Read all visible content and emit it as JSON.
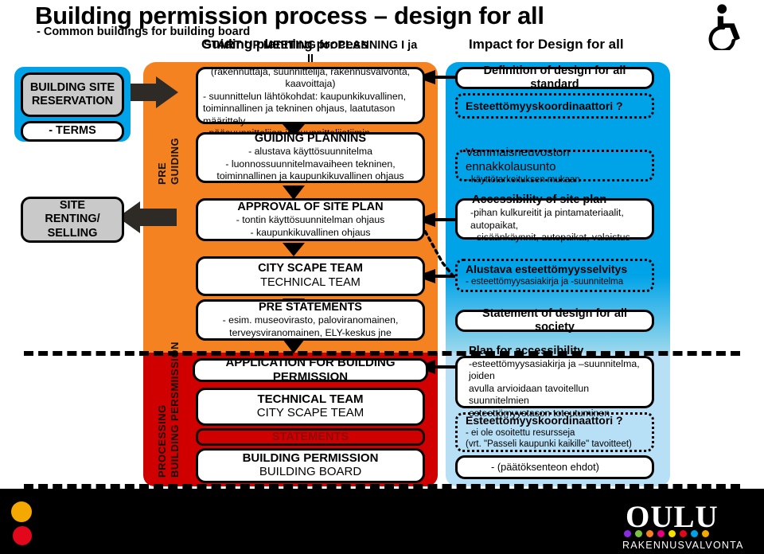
{
  "header": {
    "title": "Building permission process – design for all",
    "subtitle": "- Common buildings for building board",
    "column_middle": "Guiding planning process",
    "column_right": "Impact for Design for all",
    "icon": "wheelchair-accessibility-icon"
  },
  "bands": {
    "pre_guiding_label_line1": "PRE",
    "pre_guiding_label_line2": "GUIDING",
    "processing_label_line1": "PROCESSING",
    "processing_label_line2": "BUILDING PERSMIISSION",
    "orange_color": "#F58220",
    "red_color": "#D00000",
    "blue_color": "#00A3E8",
    "blue_light_color": "#B7E0F7"
  },
  "left_column": [
    {
      "id": "building-site-reservation",
      "title": "BUILDING SITE",
      "title2": "RESERVATION"
    },
    {
      "id": "terms",
      "title": "- TERMS"
    },
    {
      "id": "site-renting-selling",
      "title": "SITE",
      "title2": "RENTING/",
      "title3": "SELLING"
    }
  ],
  "middle_column": [
    {
      "id": "start-up-meeting",
      "heading": "START UP MEETING for PLANNING  I ja II",
      "lines": [
        "(rakennuttaja, suunnittelija, rakennusvalvonta, kaavoittaja)",
        "- suunnittelun lähtökohdat: kaupunkikuvallinen,",
        "  toiminnallinen ja tekninen ohjaus,  laatutason määrittely",
        "- pääsuunnittelijan ja suunnittelijatiimin kelpoisuus"
      ]
    },
    {
      "id": "guiding-plannins",
      "heading": "GUIDING PLANNINS",
      "lines": [
        "- alustava käyttösuunnitelma",
        "- luonnossuunnitelmavaiheen tekninen,",
        "toiminnallinen ja kaupunkikuvallinen ohjaus"
      ]
    },
    {
      "id": "approval-of-site-plan",
      "heading": "APPROVAL OF SITE PLAN",
      "lines": [
        "- tontin käyttösuunnitelman ohjaus",
        "- kaupunkikuvallinen ohjaus"
      ]
    },
    {
      "id": "city-scape-team",
      "heading": "CITY SCAPE TEAM",
      "lines": [
        "TECHNICAL TEAM"
      ]
    },
    {
      "id": "pre-statements",
      "heading": "PRE STATEMENTS",
      "lines": [
        "- esim. museovirasto, paloviranomainen,",
        "terveysviranomainen, ELY-keskus jne"
      ]
    },
    {
      "id": "application-for-building-permission",
      "heading": "APPLICATION FOR BUILDING PERMISSION",
      "lines": []
    },
    {
      "id": "technical-team",
      "heading": "TECHNICAL TEAM",
      "lines": [
        "CITY SCAPE TEAM"
      ]
    },
    {
      "id": "statements",
      "heading": "STATEMENTS",
      "lines": []
    },
    {
      "id": "building-permission",
      "heading": "BUILDING PERMISSION",
      "lines": [
        "BUILDING BOARD"
      ]
    }
  ],
  "right_column": [
    {
      "id": "definition-of-design-for-all-standard",
      "style": "solid",
      "heading": "Definition of design for all standard",
      "lines": []
    },
    {
      "id": "esteettomyyskoordinaattori-1",
      "style": "dotted",
      "heading": "Esteettömyyskoordinaattori ?",
      "lines": []
    },
    {
      "id": "vammaisneuvoston-ennakkolausunto",
      "style": "dotted-plain",
      "heading": "Vammaisneuvoston ennakkolausunto",
      "lines": [
        "- käyttötarkoituksen mukaan"
      ]
    },
    {
      "id": "accessibility-of-site-plan",
      "style": "solid",
      "heading": "Accessibility of site plan",
      "lines": [
        "-pihan kulkureitit ja pintamateriaalit, autopaikat,",
        "sisäänkäynnit, autopaikat, valaistus"
      ]
    },
    {
      "id": "alustava-esteettomyysselvitys",
      "style": "dotted",
      "heading": "Alustava esteettömyysselvitys",
      "lines": [
        "-  esteettömyysasiakirja ja -suunnitelma"
      ]
    },
    {
      "id": "statement-of-design-for-all-society",
      "style": "solid",
      "heading": "Statement of design for all society",
      "lines": []
    },
    {
      "id": "plan-for-accessibility",
      "style": "solid",
      "heading": "Plan for accessibility",
      "lines": [
        "-esteettömyysasiakirja ja –suunnitelma, joiden",
        "avulla arvioidaan tavoitellun suunnitelmien",
        "esteettömyystason toteutuminen"
      ]
    },
    {
      "id": "esteettomyyskoordinaattori-2",
      "style": "dotted",
      "heading": "Esteettömyyskoordinaattori ?",
      "lines": [
        "- ei ole osoitettu resursseja",
        "  (vrt. \"Passeli kaupunki kaikille\" tavoitteet)"
      ]
    },
    {
      "id": "paatoksenteon-ehdot",
      "style": "solid",
      "heading": "- (päätöksenteon ehdot)",
      "lines": []
    }
  ],
  "footer": {
    "logo_word": "OULU",
    "logo_sub": "RAKENNUSVALVONTA",
    "logo_dot_colors": [
      "#8A2BE2",
      "#7DC242",
      "#F5821F",
      "#E5007D",
      "#F5E000",
      "#E2071B",
      "#00A3E8",
      "#F5A800"
    ],
    "accent_dot_yellow": "#F5A800",
    "accent_dot_red": "#E2071B"
  }
}
